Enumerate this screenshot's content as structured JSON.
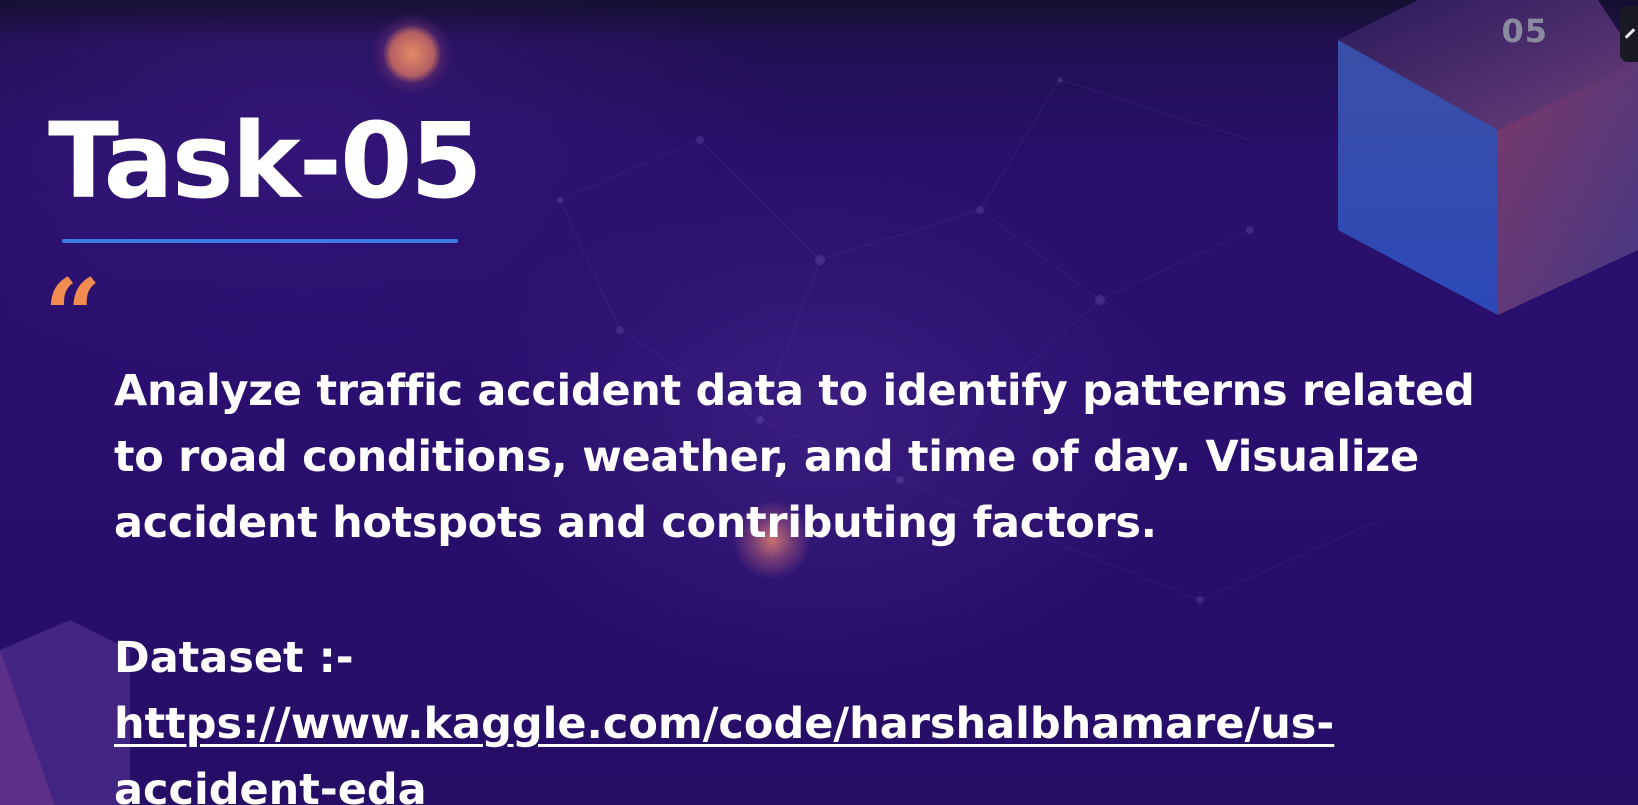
{
  "slide": {
    "number": "05",
    "title": "Task-05",
    "quote_mark": "“",
    "description": "Analyze traffic accident data to identify patterns related to road conditions, weather, and time of day. Visualize accident hotspots and contributing factors.",
    "dataset_label": "Dataset :-",
    "dataset_link": "https://www.kaggle.com/code/harshalbhamare/us-accident-eda"
  },
  "colors": {
    "background": "#2a0f6f",
    "title_text": "#ffffff",
    "underline_accent": "#3a7be8",
    "quote_accent": "#f08c4f",
    "slide_number": "#8a8aa0"
  },
  "icons": {
    "quote": "open-quote-icon",
    "cube": "cube-decoration-icon",
    "edge_handle": "resize-handle-icon"
  }
}
